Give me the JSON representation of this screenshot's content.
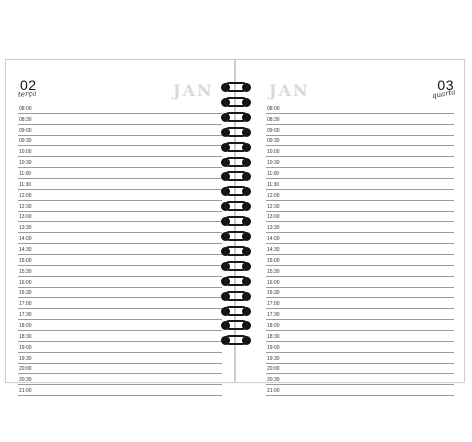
{
  "left_page": {
    "day_number": "02",
    "weekday": "terça",
    "month": "JAN",
    "times": [
      "08:00",
      "08:30",
      "09:00",
      "09:30",
      "10:00",
      "10:30",
      "11:00",
      "11:30",
      "12:00",
      "12:30",
      "13:00",
      "13:30",
      "14:00",
      "14:30",
      "15:00",
      "15:30",
      "16:00",
      "16:30",
      "17:00",
      "17:30",
      "18:00",
      "18:30",
      "19:00",
      "19:30",
      "20:00",
      "20:30",
      "21:00"
    ]
  },
  "right_page": {
    "day_number": "03",
    "weekday": "quarta",
    "month": "JAN",
    "times": [
      "08:00",
      "08:30",
      "09:00",
      "09:30",
      "10:00",
      "10:30",
      "11:00",
      "11:30",
      "12:00",
      "12:30",
      "13:00",
      "13:30",
      "14:00",
      "14:30",
      "15:00",
      "15:30",
      "16:00",
      "16:30",
      "17:00",
      "17:30",
      "18:00",
      "18:30",
      "19:00",
      "19:30",
      "20:00",
      "20:30",
      "21:00"
    ]
  },
  "binding": {
    "ring_count": 18,
    "wire_color": "#1a1a1a"
  }
}
